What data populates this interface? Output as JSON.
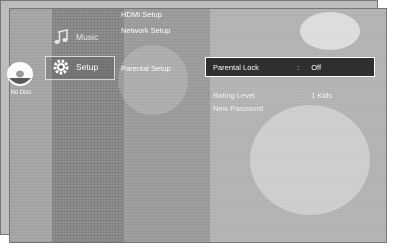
{
  "sidebar": {
    "disc_label": "No Disc"
  },
  "categories": [
    {
      "label": "Music",
      "icon": "music-note-icon"
    },
    {
      "label": "Setup",
      "icon": "gear-icon"
    }
  ],
  "submenu": {
    "items": [
      "HDMI Setup",
      "Network Setup",
      "Parental Setup"
    ]
  },
  "settings": {
    "parental_lock": {
      "label": "Parental Lock",
      "sep": ":",
      "value": "Off"
    },
    "rating_level": {
      "label": "Rating Level",
      "sep": ":",
      "value": "1 Kids"
    },
    "new_password": {
      "label": "New Password"
    }
  },
  "colors": {
    "highlight": "#2f2f2f",
    "text": "#ffffff"
  }
}
